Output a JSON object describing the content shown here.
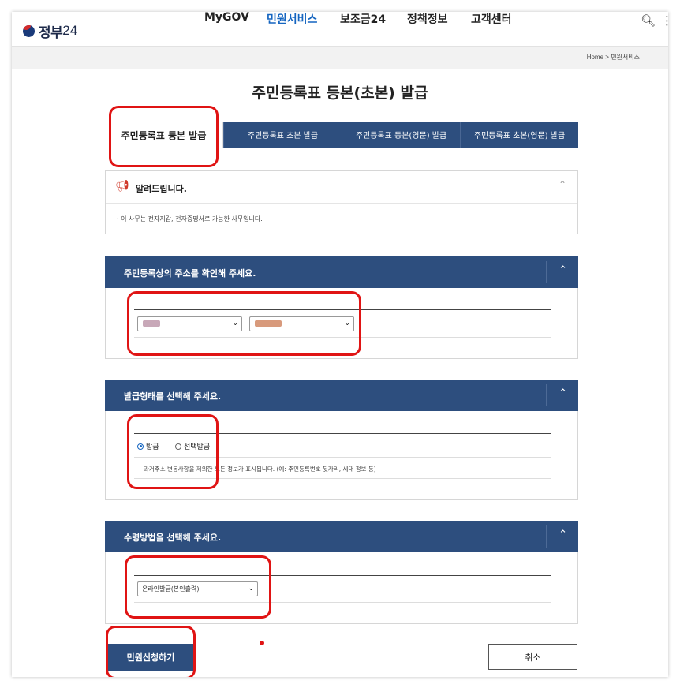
{
  "logo": {
    "name": "정부",
    "number": "24"
  },
  "nav": {
    "items": [
      "MyGOV",
      "민원서비스",
      "보조금24",
      "정책정보",
      "고객센터"
    ],
    "active": "민원서비스"
  },
  "breadcrumb": {
    "home": "Home",
    "sep": ">",
    "current": "민원서비스"
  },
  "page_title": "주민등록표 등본(초본) 발급",
  "tabs": [
    "주민등록표 등본 발급",
    "주민등록표 초본 발급",
    "주민등록표 등본(영문) 발급",
    "주민등록표 초본(영문) 발급"
  ],
  "notice": {
    "title": "알려드립니다.",
    "body": "이 사무는 전자지갑, 전자증명서로 가능한 사무입니다."
  },
  "address": {
    "title": "주민등록상의 주소를 확인해 주세요."
  },
  "issue_type": {
    "title": "발급형태를 선택해 주세요.",
    "options": [
      "발급",
      "선택발급"
    ],
    "selected": "발급",
    "hint": "과거주소 변동사항을 제외한 모든 정보가 표시됩니다. (예: 주민등록번호 뒷자리, 세대 정보 등)"
  },
  "receive": {
    "title": "수령방법을 선택해 주세요.",
    "selected": "온라인발급(본인출력)"
  },
  "buttons": {
    "apply": "민원신청하기",
    "cancel": "취소"
  },
  "colors": {
    "primary": "#2d4e7e",
    "accent": "#1565c0",
    "annotation_red": "#e01414"
  }
}
